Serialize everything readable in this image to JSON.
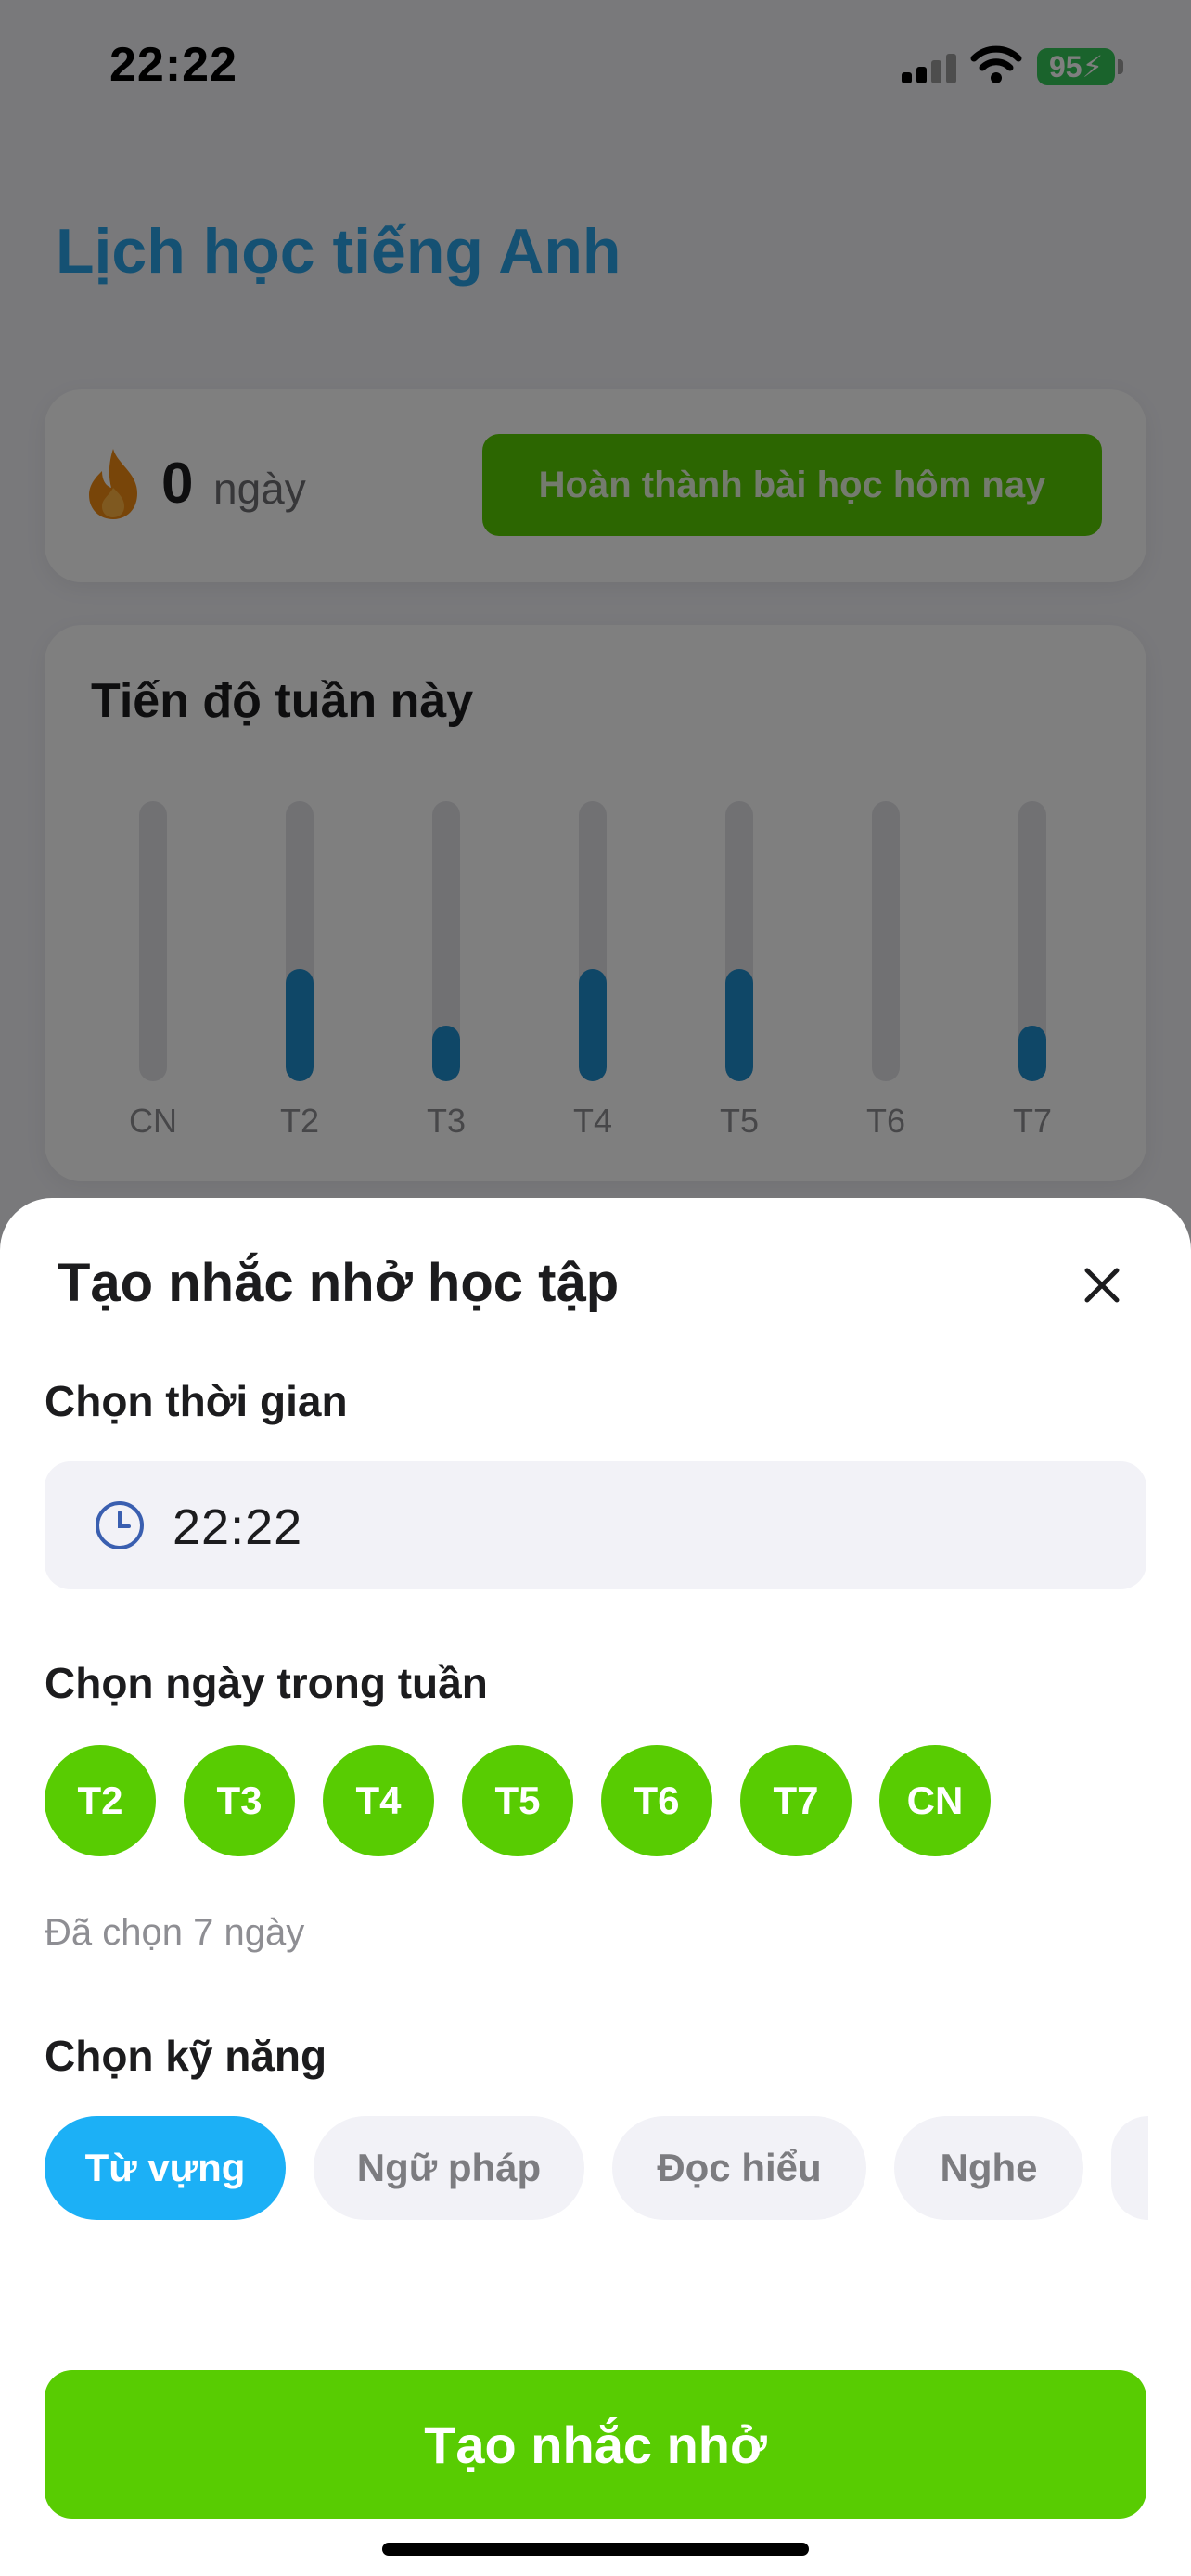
{
  "status_bar": {
    "time": "22:22",
    "battery": "95"
  },
  "page": {
    "title": "Lịch học tiếng Anh"
  },
  "streak": {
    "count": "0",
    "unit": "ngày",
    "complete_button": "Hoàn thành bài học hôm nay"
  },
  "weekly_progress": {
    "title": "Tiến độ tuần này",
    "days": [
      {
        "label": "CN",
        "fill": 0
      },
      {
        "label": "T2",
        "fill": 0.4
      },
      {
        "label": "T3",
        "fill": 0.2
      },
      {
        "label": "T4",
        "fill": 0.4
      },
      {
        "label": "T5",
        "fill": 0.4
      },
      {
        "label": "T6",
        "fill": 0
      },
      {
        "label": "T7",
        "fill": 0.2
      }
    ]
  },
  "reminder_sheet": {
    "title": "Tạo nhắc nhở học tập",
    "time_label": "Chọn thời gian",
    "time_value": "22:22",
    "days_label": "Chọn ngày trong tuần",
    "days": [
      "T2",
      "T3",
      "T4",
      "T5",
      "T6",
      "T7",
      "CN"
    ],
    "days_selected_text": "Đã chọn 7 ngày",
    "skills_label": "Chọn kỹ năng",
    "skills": [
      "Từ vựng",
      "Ngữ pháp",
      "Đọc hiểu",
      "Nghe"
    ],
    "active_skill": "Từ vựng",
    "create_button": "Tạo nhắc nhở"
  },
  "colors": {
    "accent_green": "#58cc02",
    "accent_blue": "#1cb0f6",
    "title_blue": "#2aa3e6",
    "bar_blue": "#1e8fcf"
  },
  "icons": [
    "flame-icon",
    "clock-icon",
    "close-icon",
    "wifi-icon",
    "signal-icon",
    "battery-icon"
  ]
}
